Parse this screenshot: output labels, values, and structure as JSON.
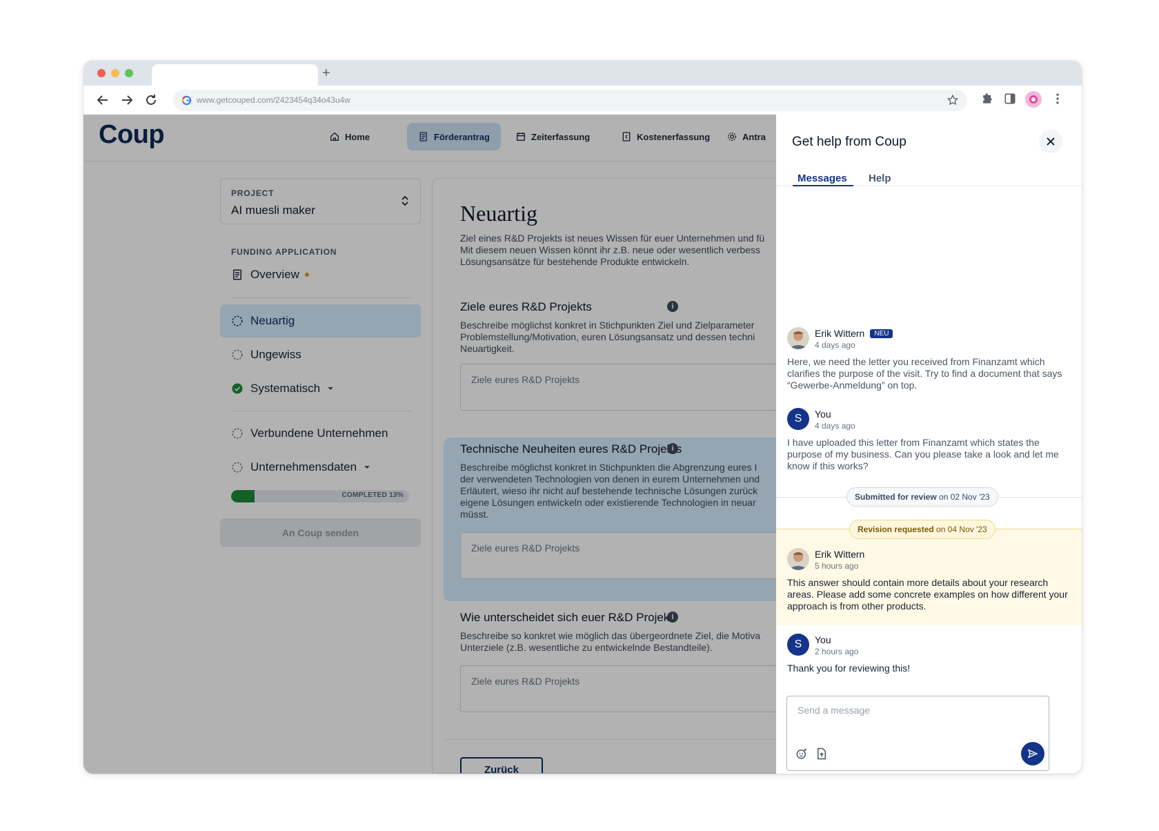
{
  "browser": {
    "url": "www.getcouped.com/2423454q34o43u4w"
  },
  "app": {
    "logo": "Coup",
    "nav": [
      {
        "label": "Home"
      },
      {
        "label": "Förderantrag"
      },
      {
        "label": "Zeiterfassung"
      },
      {
        "label": "Kostenerfassung"
      },
      {
        "label": "Antra"
      }
    ]
  },
  "sidebar": {
    "project_label": "PROJECT",
    "project_name": "AI muesli maker",
    "section_label": "FUNDING APPLICATION",
    "items": [
      {
        "label": "Overview"
      },
      {
        "label": "Neuartig"
      },
      {
        "label": "Ungewiss"
      },
      {
        "label": "Systematisch"
      },
      {
        "label": "Verbundene Unternehmen"
      },
      {
        "label": "Unternehmensdaten"
      }
    ],
    "progress_percent": 13,
    "progress_text": "COMPLETED 13%",
    "send_button": "An Coup senden"
  },
  "content": {
    "title": "Neuartig",
    "intro": [
      "Ziel eines R&D Projekts ist neues Wissen für euer Unternehmen und fü",
      "Mit diesem neuen Wissen könnt ihr z.B. neue oder wesentlich verbess",
      "Lösungsansätze für bestehende Produkte entwickeln."
    ],
    "questions": [
      {
        "title": "Ziele eures R&D Projekts",
        "desc": [
          "Beschreibe möglichst konkret in Stichpunkten Ziel und Zielparameter",
          "Problemstellung/Motivation, euren Lösungsansatz und dessen techni",
          "Neuartigkeit."
        ],
        "placeholder": "Ziele eures R&D Projekts"
      },
      {
        "title": "Technische Neuheiten eures R&D Projekts",
        "desc": [
          "Beschreibe möglichst konkret in Stichpunkten die Abgrenzung eures I",
          "der verwendeten Technologien von denen in eurem Unternehmen und",
          "Erläutert, wieso ihr nicht auf bestehende technische Lösungen zurück",
          "eigene Lösungen entwickeln oder existierende Technologien in neuar",
          "müsst."
        ],
        "placeholder": "Ziele eures R&D Projekts"
      },
      {
        "title": "Wie unterscheidet sich euer R&D Projekt",
        "desc": [
          "Beschreibe so konkret wie möglich das übergeordnete Ziel, die Motiva",
          "Unterziele (z.B. wesentliche zu entwickelnde Bestandteile)."
        ],
        "placeholder": "Ziele eures R&D Projekts"
      }
    ],
    "info_glyph": "i",
    "back_button": "Zurück"
  },
  "panel": {
    "title": "Get help from Coup",
    "tabs": [
      {
        "label": "Messages"
      },
      {
        "label": "Help"
      }
    ],
    "messages": [
      {
        "author": "Erik Wittern",
        "badge": "NEU",
        "time": "4 days ago",
        "text": "Here, we need the letter you received from Finanzamt which clarifies the purpose of the visit. Try to find a document that says “Gewerbe-Anmeldung” on top."
      },
      {
        "author": "You",
        "initial": "S",
        "time": "4 days ago",
        "text": "I have uploaded this letter from Finanzamt which states the purpose of my business. Can you please take a look and let me know if this works?"
      },
      {
        "author": "Erik Wittern",
        "time": "5 hours ago",
        "text": "This answer should contain more details about your research areas. Please add some concrete examples on how different your approach is from other products."
      },
      {
        "author": "You",
        "initial": "S",
        "time": "2 hours ago",
        "text": "Thank you for reviewing this!"
      }
    ],
    "status_submitted": {
      "label": "Submitted for review",
      "date": "on 02 Nov '23"
    },
    "status_revision": {
      "label": "Revision requested",
      "date": "on 04 Nov '23"
    },
    "composer_placeholder": "Send a message"
  },
  "colors": {
    "brand": "#0f2a5a",
    "accent": "#14338a",
    "success": "#1d8a3b",
    "warning_dot": "#e0a100",
    "revision_bg": "#fff9e6"
  }
}
